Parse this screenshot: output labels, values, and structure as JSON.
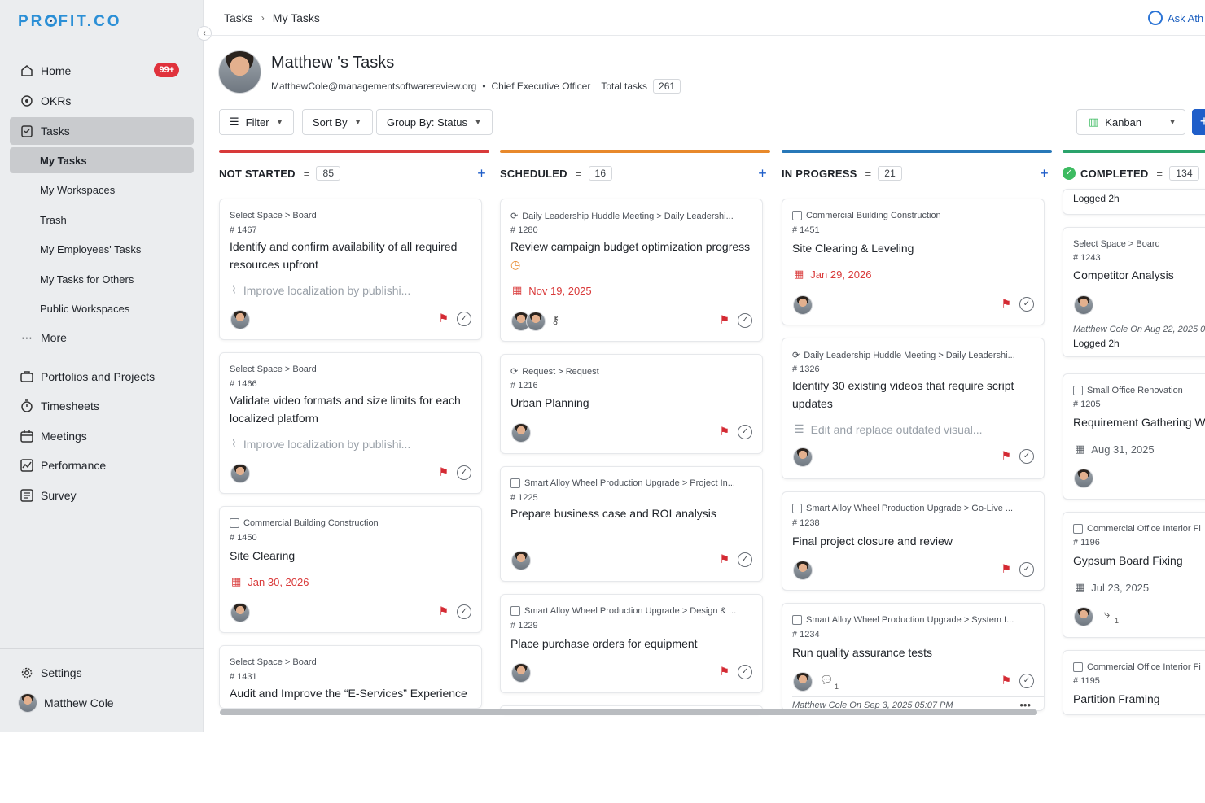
{
  "app": {
    "logo": "PROFIT.CO"
  },
  "sidebar": {
    "items": [
      {
        "label": "Home",
        "badge": "99+"
      },
      {
        "label": "OKRs"
      },
      {
        "label": "Tasks"
      },
      {
        "label": "Portfolios and Projects"
      },
      {
        "label": "Timesheets"
      },
      {
        "label": "Meetings"
      },
      {
        "label": "Performance"
      },
      {
        "label": "Survey"
      }
    ],
    "task_sub_items": [
      "My Tasks",
      "My Workspaces",
      "Trash",
      "My Employees' Tasks",
      "My Tasks for Others",
      "Public Workspaces"
    ],
    "more_label": "More",
    "settings_label": "Settings",
    "user_name": "Matthew Cole"
  },
  "header": {
    "breadcrumb": [
      "Tasks",
      "My Tasks"
    ],
    "ask_label": "Ask Ath",
    "page_title": "Matthew 's Tasks",
    "email": "MatthewCole@managementsoftwarereview.org",
    "role": "Chief Executive Officer",
    "total_tasks_label": "Total tasks",
    "total_tasks": "261"
  },
  "toolbar": {
    "filter_label": "Filter",
    "sort_label": "Sort By",
    "group_label": "Group By: Status",
    "view_label": "Kanban",
    "add_label": "+"
  },
  "colors": {
    "not_started": "#d83a3a",
    "scheduled": "#e8892b",
    "in_progress": "#2878b8",
    "completed": "#2aa36b",
    "accent": "#1f5ec9"
  },
  "columns": [
    {
      "name": "NOT STARTED",
      "count": "85",
      "cards": [
        {
          "crumb": "Select Space > Board",
          "id": "# 1467",
          "title": "Identify and confirm availability of all required resources upfront",
          "linked": "Improve localization by publishi..."
        },
        {
          "crumb": "Select Space > Board",
          "id": "# 1466",
          "title": "Validate video formats and size limits for each localized platform",
          "linked": "Improve localization by publishi..."
        },
        {
          "crumb": "Commercial Building Construction",
          "id": "# 1450",
          "title": "Site Clearing",
          "date": "Jan 30, 2026"
        },
        {
          "crumb": "Select Space > Board",
          "id": "# 1431",
          "title": "Audit and Improve the “E-Services” Experience"
        }
      ]
    },
    {
      "name": "SCHEDULED",
      "count": "16",
      "cards": [
        {
          "crumb": "Daily Leadership Huddle Meeting > Daily Leadershi...",
          "id": "# 1280",
          "title": "Review campaign budget optimization progress",
          "date": "Nov 19, 2025"
        },
        {
          "crumb": "Request > Request",
          "id": "# 1216",
          "title": "Urban Planning"
        },
        {
          "crumb": "Smart Alloy Wheel Production Upgrade > Project In...",
          "id": "# 1225",
          "title": "Prepare business case and ROI analysis"
        },
        {
          "crumb": "Smart Alloy Wheel Production Upgrade > Design & ...",
          "id": "# 1229",
          "title": "Place purchase orders for equipment"
        }
      ]
    },
    {
      "name": "IN PROGRESS",
      "count": "21",
      "cards": [
        {
          "crumb": "Commercial Building Construction",
          "id": "# 1451",
          "title": "Site Clearing & Leveling",
          "date": "Jan 29, 2026"
        },
        {
          "crumb": "Daily Leadership Huddle Meeting > Daily Leadershi...",
          "id": "# 1326",
          "title": "Identify 30 existing videos that require script updates",
          "linked": "Edit and replace outdated visual..."
        },
        {
          "crumb": "Smart Alloy Wheel Production Upgrade > Go-Live ...",
          "id": "# 1238",
          "title": "Final project closure and review"
        },
        {
          "crumb": "Smart Alloy Wheel Production Upgrade > System I...",
          "id": "# 1234",
          "title": "Run quality assurance tests",
          "comments": "1",
          "log": "Matthew Cole On Sep 3, 2025 05:07 PM"
        }
      ]
    },
    {
      "name": "COMPLETED",
      "count": "134",
      "cards": [
        {
          "partial_text": "Logged 2h"
        },
        {
          "crumb": "Select Space > Board",
          "id": "# 1243",
          "title": "Competitor Analysis",
          "log": "Matthew Cole On Aug 22, 2025 0",
          "logged": "Logged 2h"
        },
        {
          "crumb": "Small Office Renovation",
          "id": "# 1205",
          "title": "Requirement Gathering W",
          "date": "Aug 31, 2025"
        },
        {
          "crumb": "Commercial Office Interior Fi",
          "id": "# 1196",
          "title": "Gypsum Board Fixing",
          "date": "Jul 23, 2025",
          "subtasks": "1"
        },
        {
          "crumb": "Commercial Office Interior Fi",
          "id": "# 1195",
          "title": "Partition Framing"
        }
      ]
    }
  ]
}
